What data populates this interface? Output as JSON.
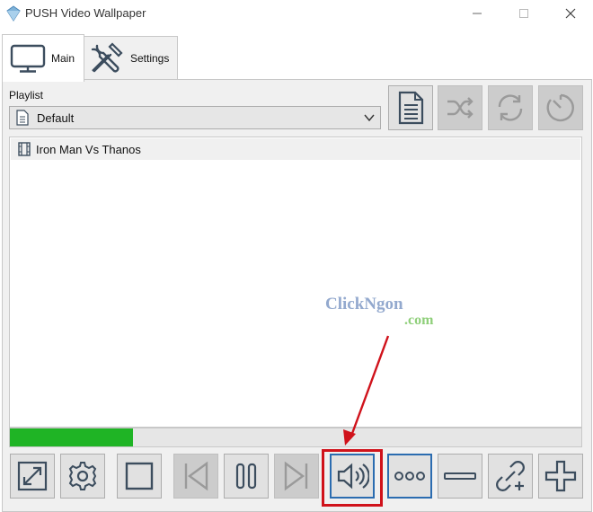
{
  "window": {
    "title": "PUSH Video Wallpaper",
    "icon": "diamond-app-icon"
  },
  "tabs": [
    {
      "label": "Main",
      "icon": "monitor-icon",
      "active": true
    },
    {
      "label": "Settings",
      "icon": "tools-icon",
      "active": false
    }
  ],
  "playlist": {
    "label": "Playlist",
    "selected": "Default",
    "icon": "document-icon"
  },
  "playlist_buttons": [
    {
      "icon": "document-lines-icon",
      "enabled": true
    },
    {
      "icon": "shuffle-icon",
      "enabled": false
    },
    {
      "icon": "repeat-icon",
      "enabled": false
    },
    {
      "icon": "timer-icon",
      "enabled": false
    }
  ],
  "videos": [
    {
      "title": "Iron Man Vs Thanos",
      "icon": "film-icon"
    }
  ],
  "progress": {
    "fraction": 0.215,
    "color": "#1fb425"
  },
  "watermark": {
    "line1": "ClickNgon",
    "line2": ".com"
  },
  "bottom_buttons": [
    {
      "icon": "fullscreen-icon",
      "enabled": true
    },
    {
      "icon": "gear-icon",
      "enabled": true
    },
    {
      "icon": "stop-icon",
      "enabled": true
    },
    {
      "icon": "previous-icon",
      "enabled": false
    },
    {
      "icon": "pause-icon",
      "enabled": true
    },
    {
      "icon": "next-icon",
      "enabled": false
    },
    {
      "icon": "volume-icon",
      "enabled": true,
      "highlighted": true
    },
    {
      "icon": "more-icon",
      "enabled": true
    },
    {
      "icon": "remove-icon",
      "enabled": true
    },
    {
      "icon": "add-link-icon",
      "enabled": true
    },
    {
      "icon": "add-icon",
      "enabled": true
    }
  ],
  "colors": {
    "accent_blue": "#2b6cb0",
    "highlight_red": "#d0121b",
    "icon_gray": "#3c4d5e"
  }
}
